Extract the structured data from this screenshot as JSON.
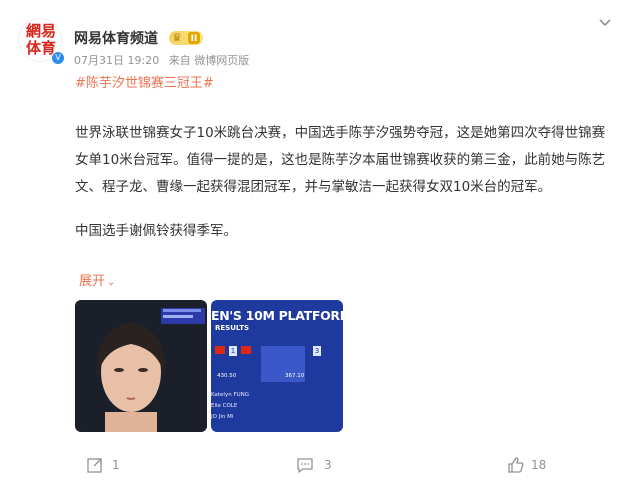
{
  "author": {
    "avatar_text_top": "網易",
    "avatar_text_bottom": "体育",
    "name": "网易体育频道",
    "level": "II",
    "verified_badge": "V"
  },
  "meta": {
    "date": "07月31日 19:20",
    "source": "来自 微博网页版"
  },
  "post": {
    "topic": "#陈芋汐世锦赛三冠王#",
    "body": "世界泳联世锦赛女子10米跳台决赛，中国选手陈芋汐强势夺冠，这是她第四次夺得世锦赛女单10米台冠军。值得一提的是，这也是陈芋汐本届世锦赛收获的第三金，此前她与陈艺文、程子龙、曹缘一起获得混团冠军，并与掌敏洁一起获得女双10米台的冠军。",
    "para2": "中国选手谢佩铃获得季军。",
    "expand_label": "展开",
    "expand_icon": "chevron-down-icon"
  },
  "images": {
    "image2": {
      "banner": "EN'S 10M PLATFORM",
      "subtitle": "RESULTS",
      "scores": [
        "430.50",
        "367.10"
      ],
      "names": [
        "Katelyn FUNG",
        "Elle COLE",
        "JO Jin Mi"
      ]
    }
  },
  "actions": {
    "forward_count": "1",
    "comment_count": "3",
    "like_count": "18"
  },
  "colors": {
    "accent": "#eb7350",
    "muted": "#939393",
    "verified": "#2c8cf0"
  }
}
